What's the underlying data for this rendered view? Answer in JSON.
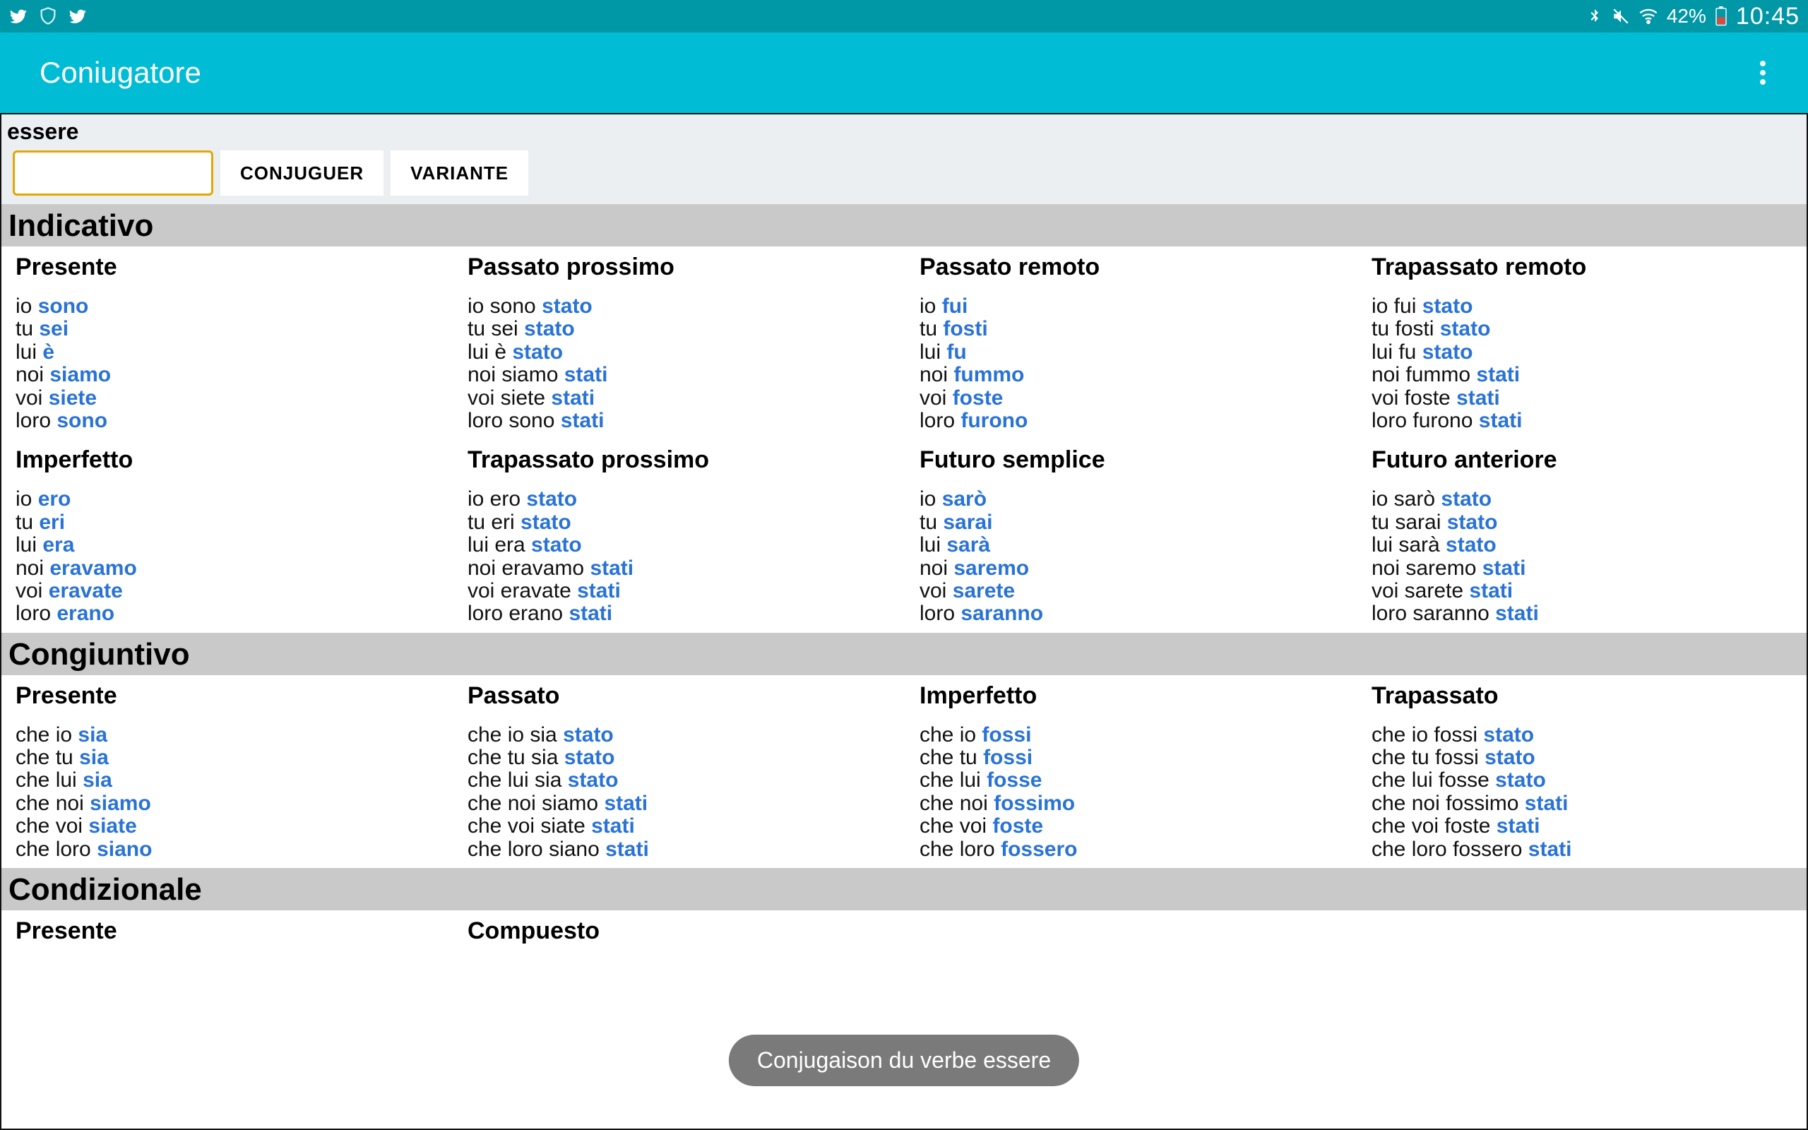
{
  "statusbar": {
    "battery": "42%",
    "clock": "10:45"
  },
  "appbar": {
    "title": "Coniugatore"
  },
  "verb_label": "essere",
  "input_value": "",
  "buttons": {
    "conjugate": "CONJUGUER",
    "variant": "VARIANTE"
  },
  "toast": "Conjugaison du verbe essere",
  "moods": [
    {
      "name": "Indicativo",
      "tenses_rows": [
        [
          {
            "name": "Presente",
            "forms": [
              {
                "pre": "io ",
                "verb": "sono"
              },
              {
                "pre": "tu ",
                "verb": "sei"
              },
              {
                "pre": "lui ",
                "verb": "è"
              },
              {
                "pre": "noi ",
                "verb": "siamo"
              },
              {
                "pre": "voi ",
                "verb": "siete"
              },
              {
                "pre": "loro ",
                "verb": "sono"
              }
            ]
          },
          {
            "name": "Passato prossimo",
            "forms": [
              {
                "pre": "io sono ",
                "verb": "stato"
              },
              {
                "pre": "tu sei ",
                "verb": "stato"
              },
              {
                "pre": "lui è ",
                "verb": "stato"
              },
              {
                "pre": "noi siamo ",
                "verb": "stati"
              },
              {
                "pre": "voi siete ",
                "verb": "stati"
              },
              {
                "pre": "loro sono ",
                "verb": "stati"
              }
            ]
          },
          {
            "name": "Passato remoto",
            "forms": [
              {
                "pre": "io ",
                "verb": "fui"
              },
              {
                "pre": "tu ",
                "verb": "fosti"
              },
              {
                "pre": "lui ",
                "verb": "fu"
              },
              {
                "pre": "noi ",
                "verb": "fummo"
              },
              {
                "pre": "voi ",
                "verb": "foste"
              },
              {
                "pre": "loro ",
                "verb": "furono"
              }
            ]
          },
          {
            "name": "Trapassato remoto",
            "forms": [
              {
                "pre": "io fui ",
                "verb": "stato"
              },
              {
                "pre": "tu fosti ",
                "verb": "stato"
              },
              {
                "pre": "lui fu ",
                "verb": "stato"
              },
              {
                "pre": "noi fummo ",
                "verb": "stati"
              },
              {
                "pre": "voi foste ",
                "verb": "stati"
              },
              {
                "pre": "loro furono ",
                "verb": "stati"
              }
            ]
          }
        ],
        [
          {
            "name": "Imperfetto",
            "forms": [
              {
                "pre": "io ",
                "verb": "ero"
              },
              {
                "pre": "tu ",
                "verb": "eri"
              },
              {
                "pre": "lui ",
                "verb": "era"
              },
              {
                "pre": "noi ",
                "verb": "eravamo"
              },
              {
                "pre": "voi ",
                "verb": "eravate"
              },
              {
                "pre": "loro ",
                "verb": "erano"
              }
            ]
          },
          {
            "name": "Trapassato prossimo",
            "forms": [
              {
                "pre": "io ero ",
                "verb": "stato"
              },
              {
                "pre": "tu eri ",
                "verb": "stato"
              },
              {
                "pre": "lui era ",
                "verb": "stato"
              },
              {
                "pre": "noi eravamo ",
                "verb": "stati"
              },
              {
                "pre": "voi eravate ",
                "verb": "stati"
              },
              {
                "pre": "loro erano ",
                "verb": "stati"
              }
            ]
          },
          {
            "name": "Futuro semplice",
            "forms": [
              {
                "pre": "io ",
                "verb": "sarò"
              },
              {
                "pre": "tu ",
                "verb": "sarai"
              },
              {
                "pre": "lui ",
                "verb": "sarà"
              },
              {
                "pre": "noi ",
                "verb": "saremo"
              },
              {
                "pre": "voi ",
                "verb": "sarete"
              },
              {
                "pre": "loro ",
                "verb": "saranno"
              }
            ]
          },
          {
            "name": "Futuro anteriore",
            "forms": [
              {
                "pre": "io sarò ",
                "verb": "stato"
              },
              {
                "pre": "tu sarai ",
                "verb": "stato"
              },
              {
                "pre": "lui sarà ",
                "verb": "stato"
              },
              {
                "pre": "noi saremo ",
                "verb": "stati"
              },
              {
                "pre": "voi sarete ",
                "verb": "stati"
              },
              {
                "pre": "loro saranno ",
                "verb": "stati"
              }
            ]
          }
        ]
      ]
    },
    {
      "name": "Congiuntivo",
      "tenses_rows": [
        [
          {
            "name": "Presente",
            "forms": [
              {
                "pre": "che io ",
                "verb": "sia"
              },
              {
                "pre": "che tu ",
                "verb": "sia"
              },
              {
                "pre": "che lui ",
                "verb": "sia"
              },
              {
                "pre": "che noi ",
                "verb": "siamo"
              },
              {
                "pre": "che voi ",
                "verb": "siate"
              },
              {
                "pre": "che loro ",
                "verb": "siano"
              }
            ]
          },
          {
            "name": "Passato",
            "forms": [
              {
                "pre": "che io sia ",
                "verb": "stato"
              },
              {
                "pre": "che tu sia ",
                "verb": "stato"
              },
              {
                "pre": "che lui sia ",
                "verb": "stato"
              },
              {
                "pre": "che noi siamo ",
                "verb": "stati"
              },
              {
                "pre": "che voi siate ",
                "verb": "stati"
              },
              {
                "pre": "che loro siano ",
                "verb": "stati"
              }
            ]
          },
          {
            "name": "Imperfetto",
            "forms": [
              {
                "pre": "che io ",
                "verb": "fossi"
              },
              {
                "pre": "che tu ",
                "verb": "fossi"
              },
              {
                "pre": "che lui ",
                "verb": "fosse"
              },
              {
                "pre": "che noi ",
                "verb": "fossimo"
              },
              {
                "pre": "che voi ",
                "verb": "foste"
              },
              {
                "pre": "che loro ",
                "verb": "fossero"
              }
            ]
          },
          {
            "name": "Trapassato",
            "forms": [
              {
                "pre": "che io fossi ",
                "verb": "stato"
              },
              {
                "pre": "che tu fossi ",
                "verb": "stato"
              },
              {
                "pre": "che lui fosse ",
                "verb": "stato"
              },
              {
                "pre": "che noi fossimo ",
                "verb": "stati"
              },
              {
                "pre": "che voi foste ",
                "verb": "stati"
              },
              {
                "pre": "che loro fossero ",
                "verb": "stati"
              }
            ]
          }
        ]
      ]
    },
    {
      "name": "Condizionale",
      "tenses_rows": [
        [
          {
            "name": "Presente",
            "forms": []
          },
          {
            "name": "Compuesto",
            "forms": []
          }
        ]
      ]
    }
  ]
}
